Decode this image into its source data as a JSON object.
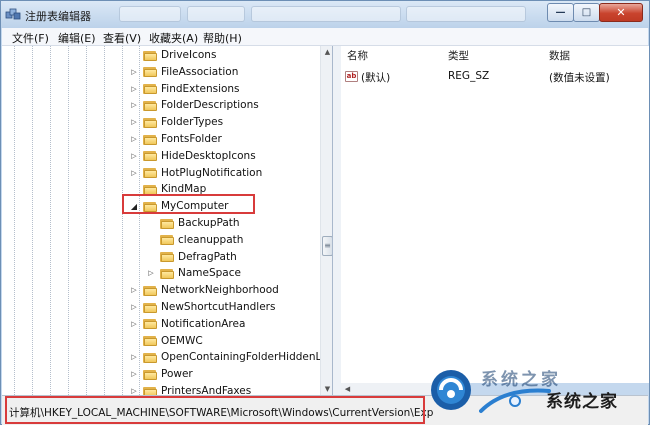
{
  "window": {
    "title": "注册表编辑器",
    "controls": {
      "minimize": "—",
      "maximize": "□",
      "close": "✕"
    }
  },
  "menubar": {
    "items": [
      {
        "label": "文件(F)"
      },
      {
        "label": "编辑(E)"
      },
      {
        "label": "查看(V)"
      },
      {
        "label": "收藏夹(A)"
      },
      {
        "label": "帮助(H)"
      }
    ]
  },
  "tree": {
    "nodes": [
      {
        "label": "DriveIcons",
        "expander": ""
      },
      {
        "label": "FileAssociation",
        "expander": "▷"
      },
      {
        "label": "FindExtensions",
        "expander": "▷"
      },
      {
        "label": "FolderDescriptions",
        "expander": "▷"
      },
      {
        "label": "FolderTypes",
        "expander": "▷"
      },
      {
        "label": "FontsFolder",
        "expander": "▷"
      },
      {
        "label": "HideDesktopIcons",
        "expander": "▷"
      },
      {
        "label": "HotPlugNotification",
        "expander": "▷"
      },
      {
        "label": "KindMap",
        "expander": ""
      },
      {
        "label": "MyComputer",
        "expander": "◢"
      },
      {
        "label": "BackupPath",
        "expander": ""
      },
      {
        "label": "cleanuppath",
        "expander": ""
      },
      {
        "label": "DefragPath",
        "expander": ""
      },
      {
        "label": "NameSpace",
        "expander": "▷"
      },
      {
        "label": "NetworkNeighborhood",
        "expander": "▷"
      },
      {
        "label": "NewShortcutHandlers",
        "expander": "▷"
      },
      {
        "label": "NotificationArea",
        "expander": "▷"
      },
      {
        "label": "OEMWC",
        "expander": ""
      },
      {
        "label": "OpenContainingFolderHiddenList",
        "expander": "▷"
      },
      {
        "label": "Power",
        "expander": "▷"
      },
      {
        "label": "PrintersAndFaxes",
        "expander": "▷"
      }
    ]
  },
  "values_pane": {
    "headers": {
      "name": "名称",
      "type": "类型",
      "data": "数据"
    },
    "rows": [
      {
        "icon": "ab",
        "name": "(默认)",
        "type": "REG_SZ",
        "data": "(数值未设置)"
      }
    ]
  },
  "statusbar": {
    "path": "计算机\\HKEY_LOCAL_MACHINE\\SOFTWARE\\Microsoft\\Windows\\CurrentVersion\\Exp"
  },
  "watermark": {
    "text": "系统之家",
    "ghost_text": "系统之家"
  },
  "colors": {
    "highlight_box": "#d83b3b",
    "folder": "#f0c75a",
    "titlebar": "#bcd2ea"
  },
  "icons": {
    "app": "registry-editor-icon",
    "folder": "folder-icon",
    "string_value": "string-value-icon"
  }
}
